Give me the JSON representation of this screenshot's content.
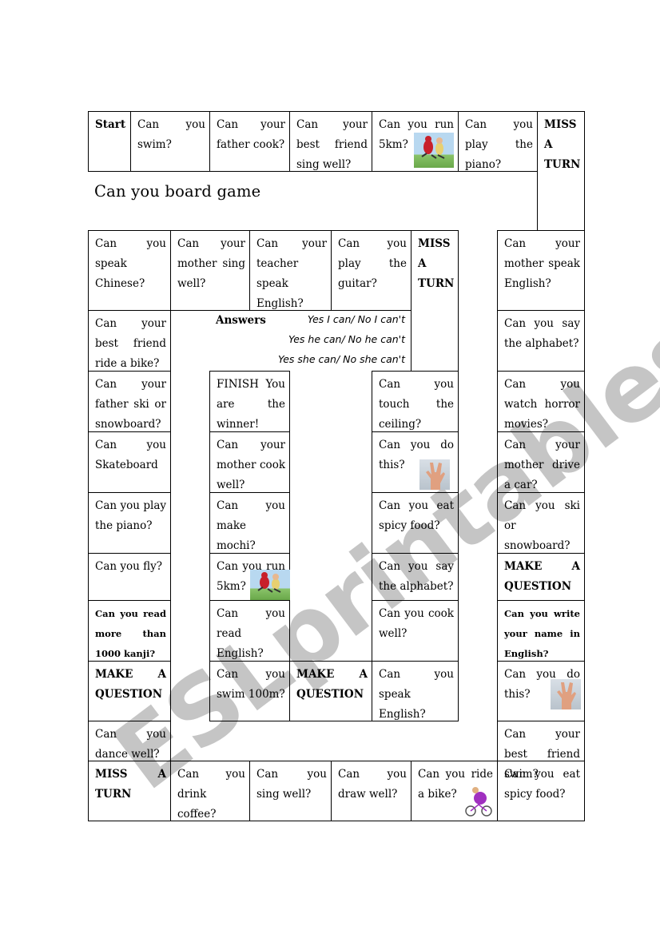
{
  "title": "Can you board game",
  "answers": {
    "label": "Answers",
    "lines": [
      "Yes I can/ No I can't",
      "Yes he can/ No he can't",
      "Yes she can/ No she can't"
    ]
  },
  "watermark": "ESLprintables.com",
  "cells": {
    "start": "Start",
    "t1": "Can you swim?",
    "t2": "Can your father cook?",
    "t3": "Can your best friend sing well?",
    "t4": "Can you run 5km?",
    "t5": "Can you play the piano?",
    "t6": "MISS A TURN",
    "r2c1": "Can you speak Chinese?",
    "r2c2": "Can your mother sing well?",
    "r2c3": "Can your teacher speak English?",
    "r2c4": "Can you play the guitar?",
    "r2c5": "MISS A TURN",
    "rt1": "Can your mother speak English?",
    "rt2": "Can you say the alphabet?",
    "rt3": "Can you watch horror movies?",
    "rt4": "Can your mother drive a car?",
    "rt5": "Can you ski or snowboard?",
    "rt6": "MAKE A QUESTION",
    "rt7": "Can you write your name in English?",
    "rt8": "Can you do this?",
    "rt9": "Can your best friend swim?",
    "l1": "Can your best friend ride a bike?",
    "l2": "Can your father ski or snowboard?",
    "l3": "Can you Skateboard",
    "l4": "Can you play the piano?",
    "l5": "Can you fly?",
    "l6": "Can you read more than 1000 kanji?",
    "l7": "MAKE A QUESTION",
    "l8": "Can you dance well?",
    "b1": "MISS A TURN",
    "b2": "Can you drink coffee?",
    "b3": "Can you sing well?",
    "b4": "Can you draw well?",
    "b5": "Can you ride a bike?",
    "b6": "Can you eat spicy food?",
    "ir1": "Can you touch the ceiling?",
    "ir2": "Can you do this?",
    "ir3": "Can you eat spicy food?",
    "ir4": "Can you say the alphabet?",
    "ir5": "Can you cook well?",
    "ir6": "Can you speak English?",
    "il1": "FINISH You are the winner!",
    "il2": "Can your mother cook well?",
    "il3": "Can you make mochi?",
    "il4": "Can you run 5km?",
    "il5": "Can you read English?",
    "il6": "Can you swim 100m?",
    "im": "MAKE A QUESTION"
  },
  "images": {
    "runners": "runners-picture",
    "hand": "vulcan-salute-hand-picture",
    "cyclist": "cyclist-picture"
  }
}
